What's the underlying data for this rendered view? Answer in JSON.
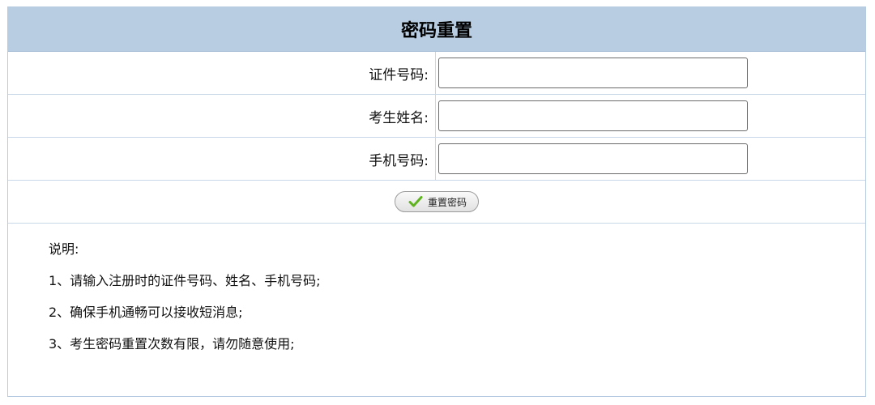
{
  "header": {
    "title": "密码重置"
  },
  "form": {
    "fields": [
      {
        "label": "证件号码:",
        "value": "",
        "placeholder": ""
      },
      {
        "label": "考生姓名:",
        "value": "",
        "placeholder": ""
      },
      {
        "label": "手机号码:",
        "value": "",
        "placeholder": ""
      }
    ],
    "submit_label": "重置密码",
    "submit_icon": "check-icon",
    "accent_color": "#b8cde1",
    "icon_color": "#5fb31f"
  },
  "notes": {
    "title": "说明:",
    "items": [
      "1、请输入注册时的证件号码、姓名、手机号码;",
      "2、确保手机通畅可以接收短消息;",
      "3、考生密码重置次数有限，请勿随意使用;"
    ]
  }
}
